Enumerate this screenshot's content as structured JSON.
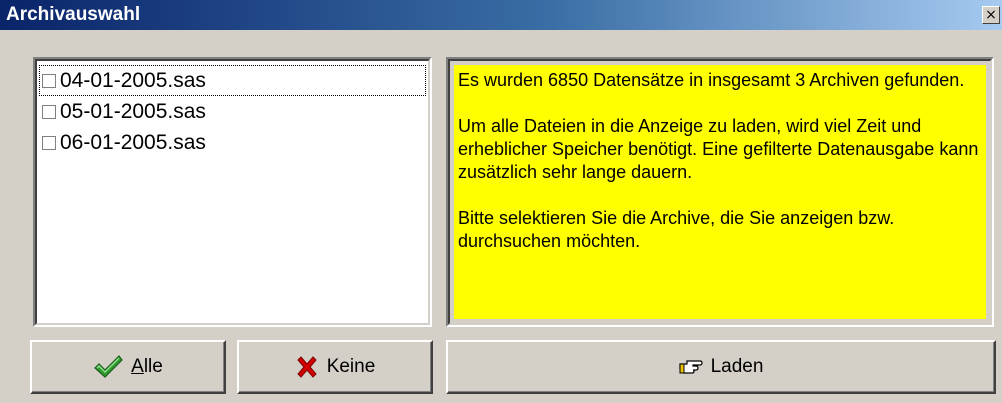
{
  "window": {
    "title": "Archivauswahl",
    "close_glyph": "×"
  },
  "archive_list": {
    "items": [
      {
        "label": "04-01-2005.sas",
        "checked": false
      },
      {
        "label": "05-01-2005.sas",
        "checked": false
      },
      {
        "label": "06-01-2005.sas",
        "checked": false
      }
    ]
  },
  "info": {
    "paragraph1": "Es wurden 6850 Datensätze in insgesamt 3 Archiven gefunden.",
    "paragraph2": "Um alle Dateien in die Anzeige zu laden, wird viel Zeit und erheblicher Speicher benötigt. Eine gefilterte Datenausgabe kann zusätzlich sehr lange dauern.",
    "paragraph3": "Bitte selektieren Sie die Archive, die Sie anzeigen bzw. durchsuchen möchten.",
    "background_color": "#ffff00"
  },
  "buttons": {
    "alle_label": "Alle",
    "alle_icon": "checkmark-icon",
    "keine_label": "Keine",
    "keine_icon": "x-mark-icon",
    "laden_label": "Laden",
    "laden_icon": "pointing-hand-icon"
  },
  "colors": {
    "title_bar_start": "#0a246a",
    "title_bar_end": "#a6caf0",
    "check_green": "#2e9b2e",
    "x_red": "#d40000"
  }
}
